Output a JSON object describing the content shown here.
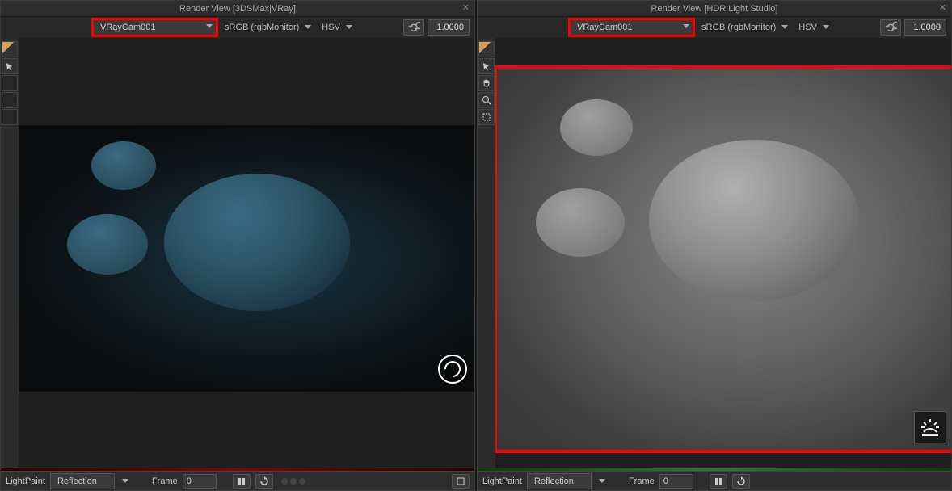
{
  "left": {
    "title": "Render View [3DSMax|VRay]",
    "camera": "VRayCam001",
    "colorspace": "sRGB (rgbMonitor)",
    "colormodel": "HSV",
    "exposure": "1.0000"
  },
  "right": {
    "title": "Render View [HDR Light Studio]",
    "camera": "VRayCam001",
    "colorspace": "sRGB (rgbMonitor)",
    "colormodel": "HSV",
    "exposure": "1.0000"
  },
  "status": {
    "mode_label": "LightPaint",
    "mode_value": "Reflection",
    "frame_label": "Frame",
    "frame_value": "0"
  }
}
